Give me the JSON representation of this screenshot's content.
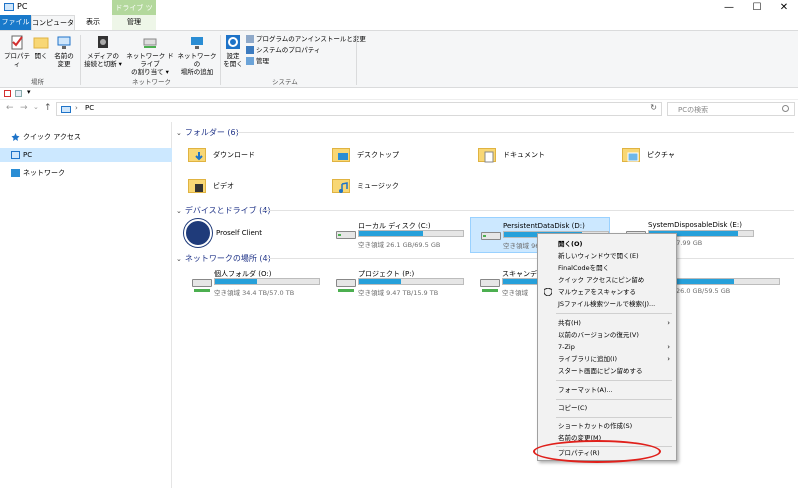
{
  "window": {
    "title": "PC",
    "min": "—",
    "max": "☐",
    "close": "✕"
  },
  "tabs": {
    "file": "ファイル",
    "computer": "コンピューター",
    "view": "表示",
    "context": "ドライブ ツール",
    "manage": "管理"
  },
  "ribbon": {
    "location": {
      "label": "場所",
      "properties": "プロパティ",
      "open": "開く",
      "rename": [
        "名前の",
        "変更"
      ]
    },
    "network": {
      "label": "ネットワーク",
      "media": [
        "メディアの",
        "接続と切断 ▾"
      ],
      "map": [
        "ネットワーク ドライブ",
        "の割り当て ▾"
      ],
      "add": [
        "ネットワークの",
        "場所の追加"
      ]
    },
    "system": {
      "label": "システム",
      "settings": [
        "設定",
        "を開く"
      ],
      "uninstall": "プログラムのアンインストールと変更",
      "sysprops": "システムのプロパティ",
      "manage": "管理"
    }
  },
  "nav": {
    "back": "←",
    "forward": "→",
    "down": "⌄",
    "up": "↑",
    "path_arrow": "›",
    "address": "PC",
    "search_placeholder": "PCの検索",
    "refresh": "↻"
  },
  "navpane": [
    {
      "label": "クイック アクセス"
    },
    {
      "label": "PC"
    },
    {
      "label": "ネットワーク"
    }
  ],
  "sections": {
    "folders": "フォルダー (6)",
    "drives": "デバイスとドライブ (4)",
    "network": "ネットワークの場所 (4)"
  },
  "folders": [
    "ダウンロード",
    "デスクトップ",
    "ドキュメント",
    "ピクチャ",
    "ビデオ",
    "ミュージック"
  ],
  "app_drive": {
    "label": "Proself Client"
  },
  "drives": [
    {
      "name": "ローカル ディスク (C:)",
      "free": "空き領域 26.1 GB/69.5 GB",
      "used": 0.62
    },
    {
      "name": "PersistentDataDisk (D:)",
      "free": "空き領域 96",
      "used": 0.75
    },
    {
      "name": "SystemDisposableDisk (E:)",
      "free": "1.13 GB/7.99 GB",
      "used": 0.86
    }
  ],
  "network_drives": [
    {
      "name": "個人フォルダ (O:)",
      "free": "空き領域 34.4 TB/57.0 TB",
      "used": 0.4
    },
    {
      "name": "プロジェクト (P:)",
      "free": "空き領域 9.47 TB/15.9 TB",
      "used": 0.4
    },
    {
      "name": "スキャンデー",
      "free": "空き領域",
      "used": 0.4
    },
    {
      "name": ")",
      "free": "26.0 GB/59.5 GB",
      "used": 0.56
    }
  ],
  "context_menu": [
    "開く(O)",
    "新しいウィンドウで開く(E)",
    "FinalCodeを開く",
    "クイック アクセスにピン留め",
    "マルウェアをスキャンする",
    "JSファイル検索ツールで検索(J)...",
    "共有(H)",
    "以前のバージョンの復元(V)",
    "7-Zip",
    "ライブラリに追加(I)",
    "スタート画面にピン留めする",
    "フォーマット(A)...",
    "コピー(C)",
    "ショートカットの作成(S)",
    "名前の変更(M)",
    "プロパティ(R)"
  ],
  "submenu_arrow": "›"
}
